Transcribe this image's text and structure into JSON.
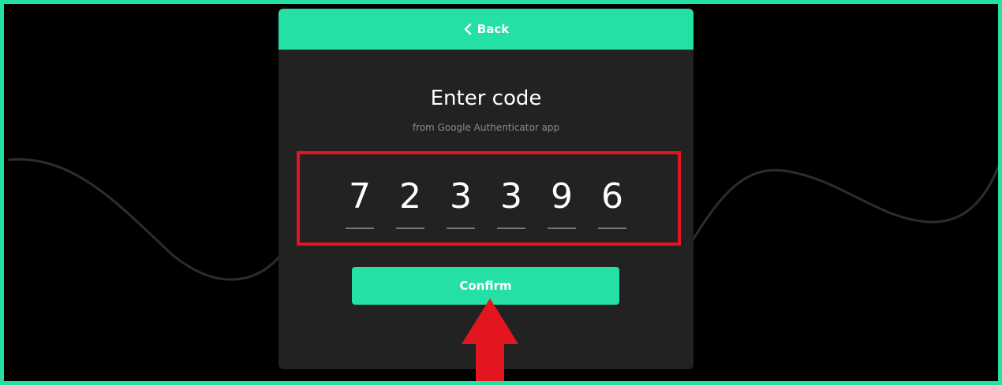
{
  "header": {
    "back_label": "Back"
  },
  "main": {
    "title": "Enter code",
    "subtitle": "from Google Authenticator app",
    "code_digits": [
      "7",
      "2",
      "3",
      "3",
      "9",
      "6"
    ],
    "confirm_label": "Confirm"
  },
  "colors": {
    "accent": "#24e0a4",
    "card_background": "#222222",
    "page_background": "#000000",
    "highlight_box": "#e3151f",
    "annotation_arrow": "#e3151f"
  },
  "icons": {
    "back": "chevron-left-icon",
    "annotation": "up-arrow-icon"
  }
}
